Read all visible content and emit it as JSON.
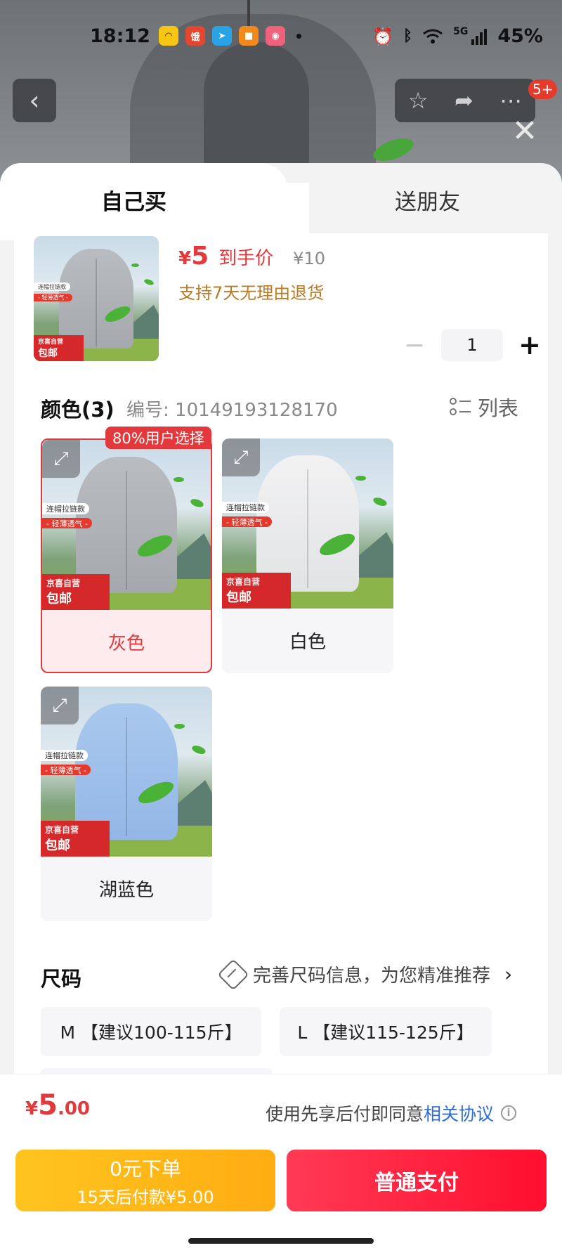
{
  "status_bar": {
    "time": "18:12",
    "network": "5G",
    "battery": "45%",
    "notification_icons": [
      "app-icon-yellow",
      "app-icon-red",
      "telegram-icon",
      "app-icon-orange",
      "app-icon-pink"
    ]
  },
  "nav": {
    "back_icon": "chevron-left-icon",
    "favorite_icon": "star-icon",
    "share_icon": "share-icon",
    "more_icon": "more-icon",
    "message_badge": "5+"
  },
  "tabs": [
    {
      "label": "自己买",
      "active": true
    },
    {
      "label": "送朋友",
      "active": false
    }
  ],
  "product": {
    "price_symbol": "¥",
    "price": "5",
    "price_tag": "到手价",
    "original_price": "¥10",
    "return_policy": "支持7天无理由退货",
    "quantity": "1",
    "image_tags": {
      "feature1": "连帽拉链款",
      "feature2": "- 轻薄透气 -",
      "seal_top": "京喜自营",
      "seal_bottom": "包邮"
    }
  },
  "color_section": {
    "title": "颜色(3)",
    "item_code": "编号: 10149193128170",
    "list_toggle": "列表",
    "popular_badge": "80%用户选择",
    "options": [
      {
        "name": "灰色",
        "selected": true
      },
      {
        "name": "白色",
        "selected": false
      },
      {
        "name": "湖蓝色",
        "selected": false
      }
    ]
  },
  "size_section": {
    "title": "尺码",
    "guide_text": "完善尺码信息，为您精准推荐",
    "options": [
      {
        "label": "M 【建议100-115斤】"
      },
      {
        "label": "L 【建议115-125斤】"
      }
    ]
  },
  "footer": {
    "total_symbol": "¥",
    "total_int": "5",
    "total_dec": ".00",
    "agreement_prefix": "使用先享后付即同意",
    "agreement_link": "相关协议",
    "bnpl_line1": "0元下单",
    "bnpl_line2": "15天后付款¥5.00",
    "pay_button": "普通支付"
  },
  "colors": {
    "accent_red": "#e4393c",
    "link_blue": "#2a6ed8",
    "bnpl_yellow": "#ffb618",
    "pay_red": "#ff1f3d",
    "policy_brown": "#b87a22"
  }
}
